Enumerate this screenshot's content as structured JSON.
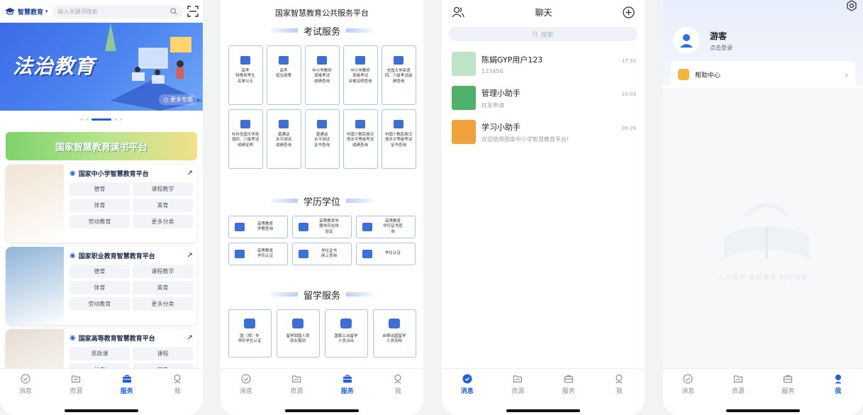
{
  "tabs": [
    {
      "label": "消息",
      "icon": "message-check-icon"
    },
    {
      "label": "资源",
      "icon": "folder-icon"
    },
    {
      "label": "服务",
      "icon": "briefcase-icon"
    },
    {
      "label": "我",
      "icon": "person-icon"
    }
  ],
  "home": {
    "logo_text": "智慧教育",
    "search_placeholder": "输入关键词搜索",
    "banner_title": "法治教育",
    "banner_more": "更多专题",
    "reading_banner": "国家智慧教育读书平台",
    "cards": [
      {
        "name": "国家中小学智慧教育平台",
        "chips": [
          "德育",
          "课程教学",
          "体育",
          "美育",
          "劳动教育",
          "更多分类"
        ],
        "color": "#f1e3d3"
      },
      {
        "name": "国家职业教育智慧教育平台",
        "chips": [
          "德育",
          "课程教学",
          "体育",
          "美育",
          "劳动教育",
          "更多分类"
        ],
        "color": "#8fb4d8"
      },
      {
        "name": "国家高等教育智慧教育平台",
        "chips": [
          "思政课",
          "课程",
          "体育",
          "美育"
        ],
        "color": "#e6ddd3"
      }
    ]
  },
  "services": {
    "title": "国家智慧教育公共服务平台",
    "exam_title": "考试服务",
    "exam_tiles": [
      "高考\n特殊类考生\n名单公示",
      "高考\n招生政策",
      "中小学教师\n资格考试\n成绩查询",
      "中小学教师\n资格考试\n合格证明查询",
      "全国大学英语\n四、六级考试成\n绩查询",
      "补办全国大学英\n语四、六级考试\n成绩证明",
      "普通话\n水平测试\n成绩查询",
      "普通话\n水平测试\n证书查询",
      "中国少数民族汉\n语水平等级考试\n成绩查询",
      "中国少数民族汉\n语水平等级考试\n证书查询"
    ],
    "degree_title": "学历学位",
    "degree_tiles": [
      "高等教育\n学籍查询",
      "高等教育学\n籍学历在线\n验证",
      "高等教育\n学历证书查\n询",
      "高等教育\n学历认证",
      "学位证书\n网上查询",
      "学位认证"
    ],
    "abroad_title": "留学服务",
    "abroad_tiles": [
      "国（境）外\n学历学位认证",
      "留学回国人员\n就业报到",
      "国家公派留学\n人员派出",
      "自费出国留学\n人员存档"
    ]
  },
  "chat": {
    "title": "聊天",
    "search_placeholder": "搜索",
    "messages": [
      {
        "name": "陈娟GYP用户123",
        "sub": "123456",
        "time": "17:32",
        "avatar_color": "#bfe3c8"
      },
      {
        "name": "管理小助手",
        "sub": "好友申请",
        "time": "10-03",
        "avatar_color": "#4fb06a"
      },
      {
        "name": "学习小助手",
        "sub": "欢迎使用国家中小学智慧教育平台!",
        "time": "09-28",
        "avatar_color": "#f2a23a"
      }
    ]
  },
  "me": {
    "name": "游客",
    "login_hint": "点击登录",
    "help_center": "帮助中心",
    "motto": "人人皆学  处处能学  时时可学"
  },
  "colors": {
    "accent": "#1f5fe0",
    "tile_border": "#a9c3ef"
  }
}
